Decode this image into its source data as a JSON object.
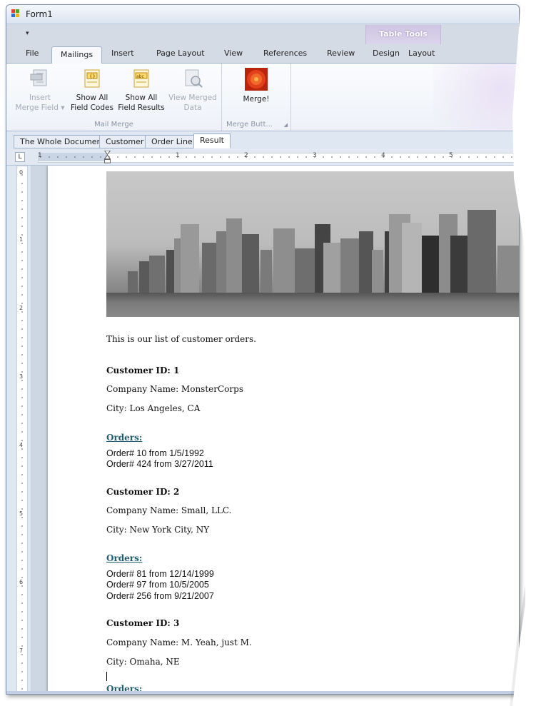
{
  "window": {
    "title": "Form1"
  },
  "quick_access": {
    "dropdown_icon": "▾"
  },
  "ribbon_tabs": [
    "File",
    "Mailings",
    "Insert",
    "Page Layout",
    "View",
    "References",
    "Review",
    "Design",
    "Layout"
  ],
  "contextual_group": {
    "label": "Table Tools"
  },
  "ribbon": {
    "mail_merge": {
      "label": "Mail Merge",
      "insert_merge_field": "Insert\nMerge Field ▾",
      "show_all_field_codes": "Show All\nField Codes",
      "show_all_field_results": "Show All\nField Results",
      "view_merged_data": "View Merged\nData"
    },
    "merge_buttons": {
      "label": "Merge Butt...",
      "merge": "Merge!"
    }
  },
  "doc_tabs": [
    "The Whole Document",
    "Customer",
    "Order Line",
    "Result"
  ],
  "ruler": {
    "corner": "L",
    "h_numbers": [
      "1",
      "1",
      "2",
      "3",
      "4",
      "5"
    ],
    "v_numbers": [
      "0",
      "1",
      "2",
      "3",
      "4",
      "5",
      "6",
      "7"
    ]
  },
  "document": {
    "intro": "This is our list of customer orders.",
    "customers": [
      {
        "id_line": "Customer ID: 1",
        "company_line": "Company Name: MonsterCorps",
        "city_line": "City: Los Angeles, CA",
        "orders_heading": "Orders:",
        "orders": [
          "Order# 10 from 1/5/1992",
          "Order# 424 from 3/27/2011"
        ]
      },
      {
        "id_line": "Customer ID: 2",
        "company_line": "Company Name: Small, LLC.",
        "city_line": "City: New York City, NY",
        "orders_heading": "Orders:",
        "orders": [
          "Order# 81 from 12/14/1999",
          "Order# 97 from 10/5/2005",
          "Order# 256 from 9/21/2007"
        ]
      },
      {
        "id_line": "Customer ID: 3",
        "company_line": "Company Name: M. Yeah, just M.",
        "city_line": "City: Omaha, NE",
        "orders_heading": "Orders:"
      }
    ]
  },
  "colors": {
    "accent_orders": "#1f5d6e",
    "window_frame": "#7a8ca8",
    "contextual": "#cfc6e4"
  }
}
